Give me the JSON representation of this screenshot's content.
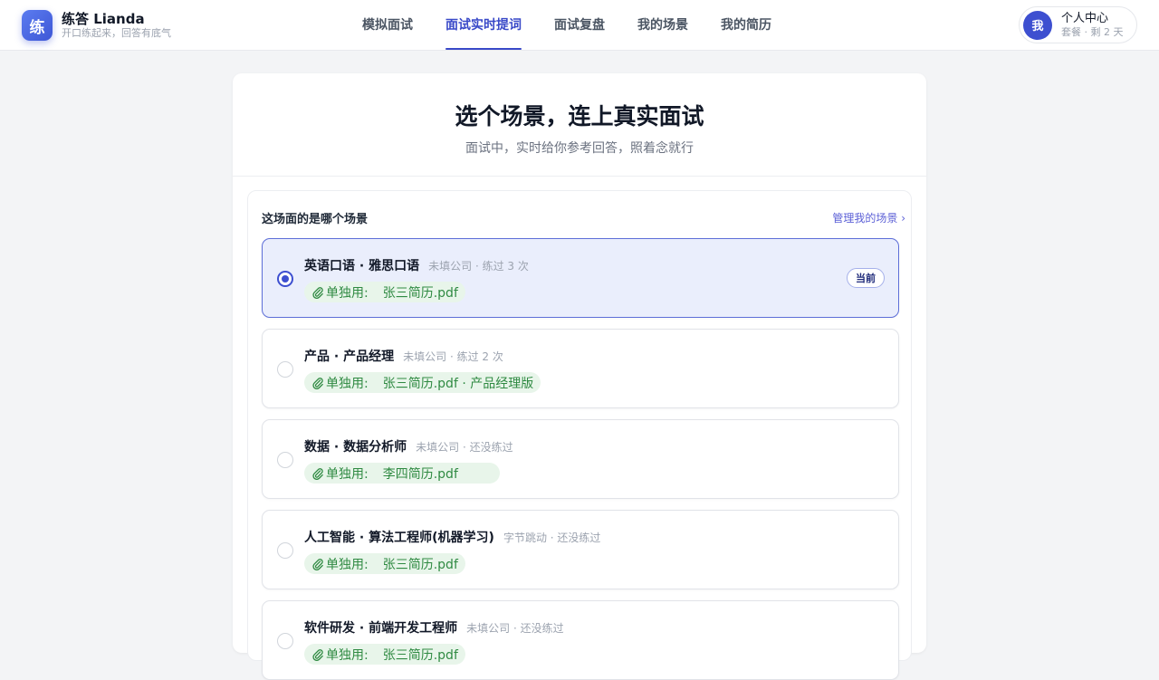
{
  "brand": {
    "logo_char": "练",
    "name": "练答 Lianda",
    "slogan": "开口练起来，回答有底气"
  },
  "nav": {
    "items": [
      {
        "label": "模拟面试",
        "active": false
      },
      {
        "label": "面试实时提词",
        "active": true
      },
      {
        "label": "面试复盘",
        "active": false
      },
      {
        "label": "我的场景",
        "active": false
      },
      {
        "label": "我的简历",
        "active": false
      }
    ]
  },
  "user": {
    "avatar_char": "我",
    "title": "个人中心",
    "plan": "套餐 · 剩 2 天"
  },
  "hero": {
    "title": "选个场景，连上真实面试",
    "subtitle": "面试中，实时给你参考回答，照着念就行"
  },
  "panel": {
    "title": "这场面的是哪个场景",
    "manage_link": "管理我的场景 ›"
  },
  "scenes": [
    {
      "name": "英语口语 · 雅思口语",
      "meta": "未填公司 · 练过 3 次",
      "chip_label": "单独用:",
      "resume": "张三简历.pdf",
      "selected": true,
      "badge": "当前"
    },
    {
      "name": "产品 · 产品经理",
      "meta": "未填公司 · 练过 2 次",
      "chip_label": "单独用:",
      "resume": "张三简历.pdf · 产品经理版",
      "selected": false,
      "badge": ""
    },
    {
      "name": "数据 · 数据分析师",
      "meta": "未填公司 · 还没练过",
      "chip_label": "单独用:",
      "resume": "李四简历.pdf",
      "selected": false,
      "badge": ""
    },
    {
      "name": "人工智能 · 算法工程师(机器学习)",
      "meta": "字节跳动 · 还没练过",
      "chip_label": "单独用:",
      "resume": "张三简历.pdf",
      "selected": false,
      "badge": ""
    },
    {
      "name": "软件研发 · 前端开发工程师",
      "meta": "未填公司 · 还没练过",
      "chip_label": "单独用:",
      "resume": "张三简历.pdf",
      "selected": false,
      "badge": ""
    }
  ],
  "colors": {
    "accent": "#3949c8",
    "selected_bg": "#eaeefc",
    "chip_bg": "#e8f5ea",
    "chip_text": "#2f8a42"
  },
  "icons": {
    "attachment": "paperclip-icon"
  }
}
